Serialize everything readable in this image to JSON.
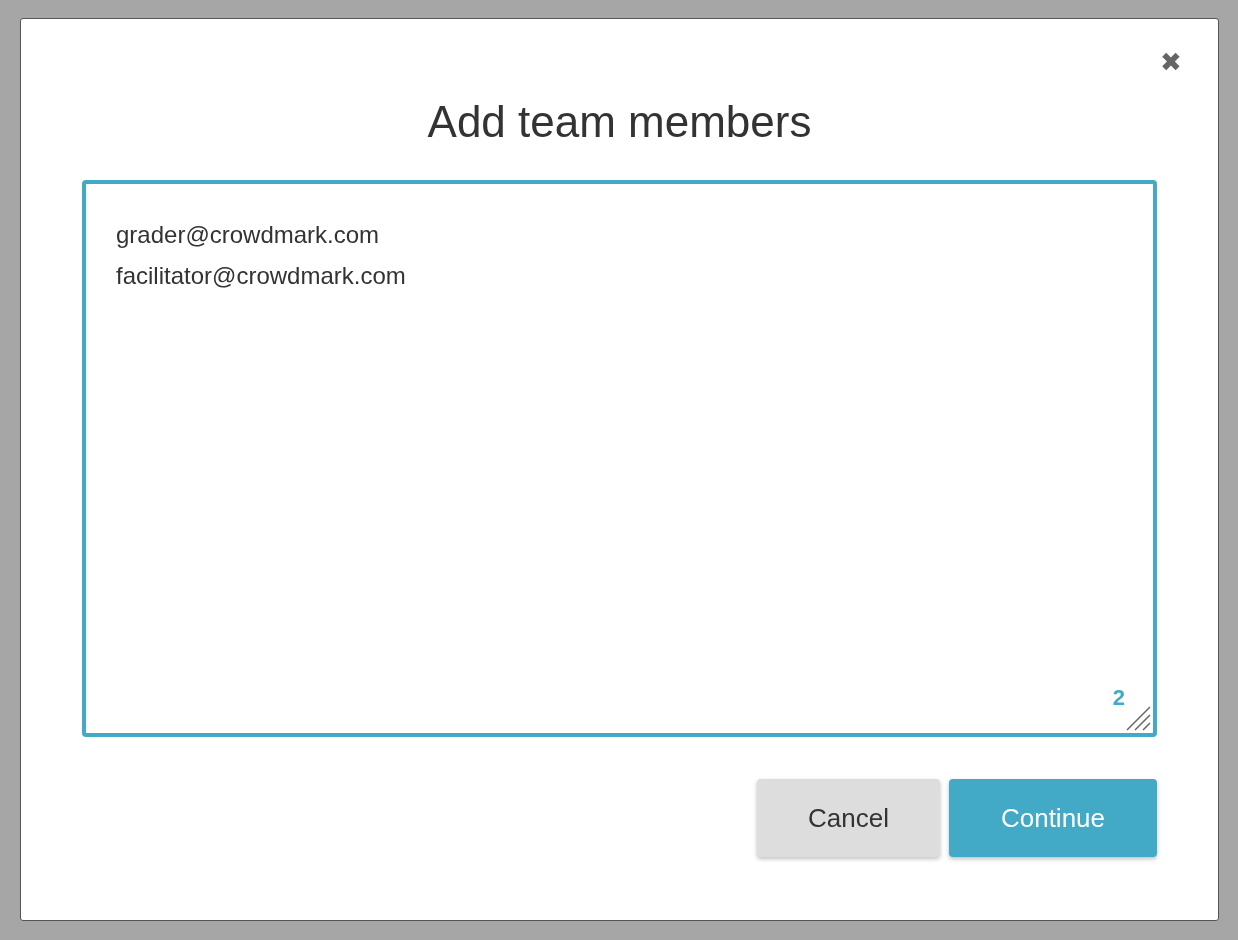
{
  "dialog": {
    "title": "Add team members",
    "close_label": "✖",
    "emails": {
      "value": "grader@crowdmark.com\nfacilitator@crowdmark.com",
      "count": "2"
    },
    "buttons": [
      {
        "kind": "secondary",
        "label": "Cancel"
      },
      {
        "kind": "primary",
        "label": "Continue"
      }
    ]
  }
}
